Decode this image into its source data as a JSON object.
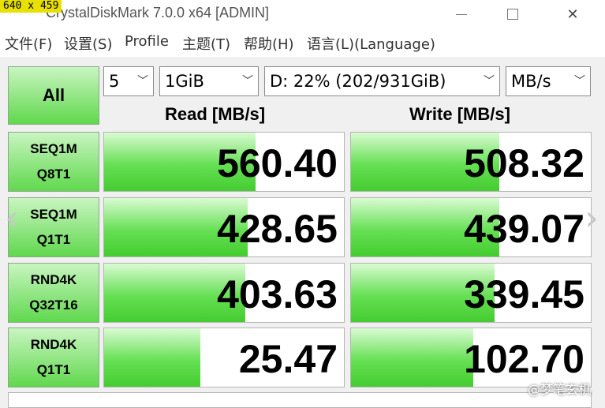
{
  "overlay": {
    "dimensions": "640 x 459",
    "watermark": "@梦笔玄机"
  },
  "window": {
    "title": "CrystalDiskMark 7.0.0 x64 [ADMIN]",
    "minimize": "—",
    "close": "✕"
  },
  "menu": [
    "文件(F)",
    "设置(S)",
    "Profile",
    "主题(T)",
    "帮助(H)",
    "语言(L)(Language)"
  ],
  "controls": {
    "all_label": "All",
    "count": "5",
    "size": "1GiB",
    "drive": "D: 22% (202/931GiB)",
    "unit": "MB/s",
    "chevron": "﹀"
  },
  "headers": {
    "read": "Read [MB/s]",
    "write": "Write [MB/s]"
  },
  "tests": [
    {
      "line1": "SEQ1M",
      "line2": "Q8T1",
      "read": "560.40",
      "write": "508.32"
    },
    {
      "line1": "SEQ1M",
      "line2": "Q1T1",
      "read": "428.65",
      "write": "439.07"
    },
    {
      "line1": "RND4K",
      "line2": "Q32T16",
      "read": "403.63",
      "write": "339.45"
    },
    {
      "line1": "RND4K",
      "line2": "Q1T1",
      "read": "25.47",
      "write": "102.70"
    }
  ],
  "bar_fractions": {
    "read": [
      0.63,
      0.6,
      0.59,
      0.4
    ],
    "write": [
      0.62,
      0.62,
      0.6,
      0.51
    ]
  },
  "nav": {
    "prev": "‹",
    "next": "›"
  }
}
